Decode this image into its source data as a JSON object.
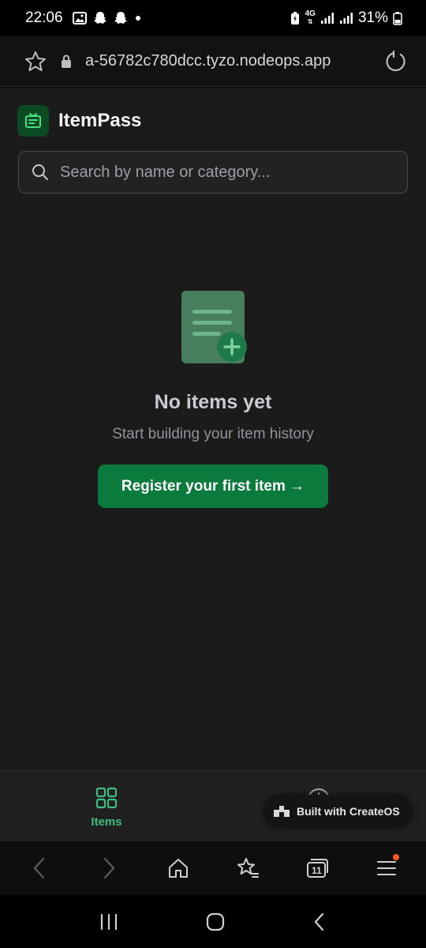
{
  "status_bar": {
    "time": "22:06",
    "battery": "31%",
    "network": "4G"
  },
  "browser": {
    "url": "a-56782c780dcc.tyzo.nodeops.app"
  },
  "app": {
    "title": "ItemPass",
    "search": {
      "placeholder": "Search by name or category..."
    },
    "empty_state": {
      "title": "No items yet",
      "subtitle": "Start building your item history",
      "cta_label": "Register your first item →"
    },
    "bottom_nav": {
      "items_label": "Items"
    },
    "badge": "Built with CreateOS"
  },
  "browser_toolbar": {
    "tab_count": "11"
  },
  "colors": {
    "accent": "#0b7a3d",
    "accent_light": "#3fbf7f",
    "background": "#1b1b1b"
  }
}
